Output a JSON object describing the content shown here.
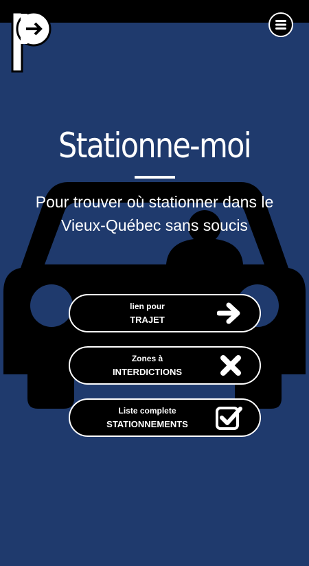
{
  "header": {
    "logo_icon": "parking-arrow-logo",
    "menu_icon": "hamburger-icon"
  },
  "hero": {
    "title": "Stationne-moi",
    "subtitle": "Pour trouver où stationner dans le Vieux-Québec sans soucis",
    "background_icon": "car-icon"
  },
  "actions": [
    {
      "small": "lien pour",
      "big": "TRAJET",
      "icon": "arrow-right-icon"
    },
    {
      "small": "Zones à",
      "big": "INTERDICTIONS",
      "icon": "x-icon"
    },
    {
      "small": "Liste complete",
      "big": "STATIONNEMENTS",
      "icon": "checkbox-check-icon"
    }
  ],
  "colors": {
    "background": "#1f3a6d",
    "topbar": "#000000",
    "button": "#000000",
    "text": "#ffffff"
  }
}
